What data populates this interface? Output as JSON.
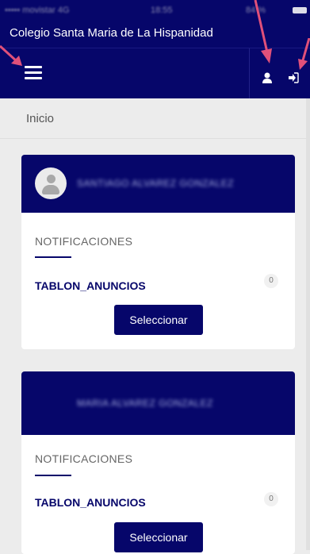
{
  "status_bar": {
    "left_text": "••••• movistar 4G",
    "time": "18:55",
    "right_text": "84 %"
  },
  "header": {
    "app_title": "Colegio Santa Maria de La Hispanidad"
  },
  "nav": {
    "menu_icon": "hamburger-menu-icon",
    "profile_icon": "user-icon",
    "logout_icon": "sign-out-icon"
  },
  "breadcrumb": "Inicio",
  "cards": [
    {
      "user_name": "SANTIAGO ALVAREZ GONZALEZ",
      "section_title": "NOTIFICACIONES",
      "item_name": "TABLON_ANUNCIOS",
      "count": "0",
      "button_label": "Seleccionar"
    },
    {
      "user_name": "MARIA ALVAREZ GONZALEZ",
      "section_title": "NOTIFICACIONES",
      "item_name": "TABLON_ANUNCIOS",
      "count": "0",
      "button_label": "Seleccionar"
    }
  ],
  "colors": {
    "brand_navy": "#06066a",
    "arrow_pink": "#e0507a"
  }
}
